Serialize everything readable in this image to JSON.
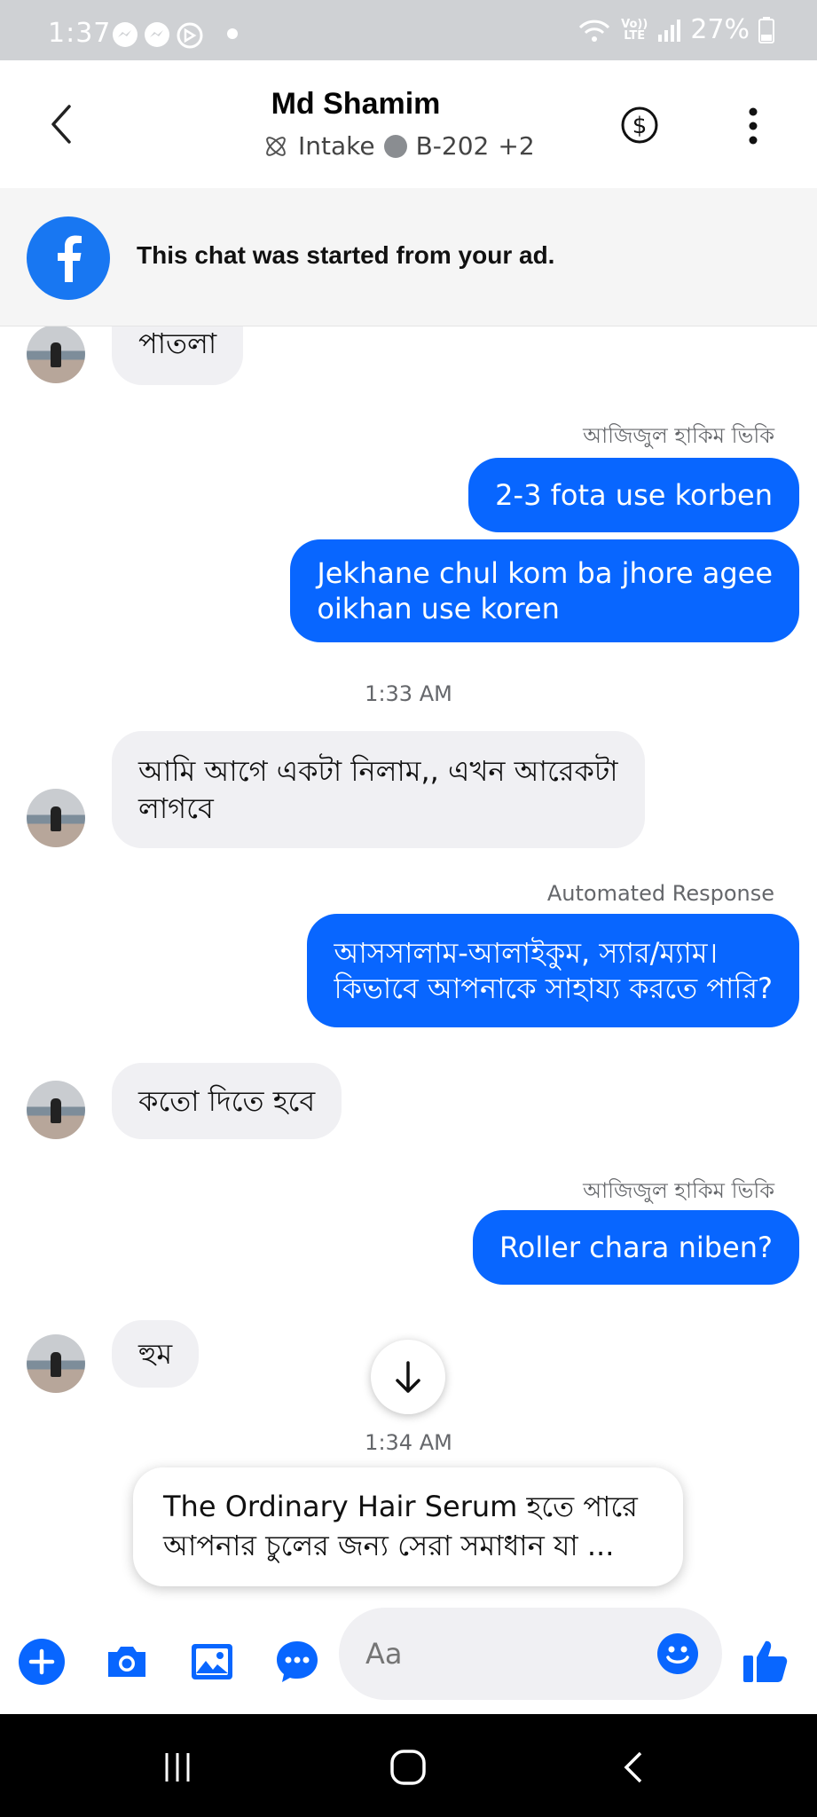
{
  "status_bar": {
    "time": "1:37",
    "battery": "27%",
    "network_label_top": "Vo))",
    "network_label_bottom": "LTE"
  },
  "header": {
    "contact_name": "Md Shamim",
    "label_intake": "Intake",
    "label_b202": "B-202",
    "label_more": "+2"
  },
  "ad_banner": {
    "text": "This chat was started from your ad."
  },
  "messages": {
    "m1_in": "পাতলা",
    "sender1": "আজিজুল হাকিম ভিকি",
    "m2_out": "2-3 fota use korben",
    "m3_out_line1": "Jekhane chul kom ba jhore agee",
    "m3_out_line2": "oikhan use koren",
    "time1": "1:33 AM",
    "m4_in_line1": "আমি আগে একটা নিলাম,, এখন আরেকটা",
    "m4_in_line2": "লাগবে",
    "sender2": "Automated Response",
    "m5_out_line1": "আসসালাম-আলাইকুম, স্যার/ম্যাম।",
    "m5_out_line2": "কিভাবে আপনাকে সাহায্য করতে পারি?",
    "m6_in": "কতো দিতে হবে",
    "sender3": "আজিজুল হাকিম ভিকি",
    "m7_out": "Roller chara niben?",
    "m8_in": "হুম",
    "time2": "1:34 AM"
  },
  "preview": {
    "line1": "The Ordinary Hair Serum হতে পারে",
    "line2": "আপনার চুলের জন্য সেরা সমাধান যা ..."
  },
  "composer": {
    "placeholder": "Aa"
  },
  "colors": {
    "accent": "#0866ff",
    "incoming_bubble": "#f0f0f3",
    "facebook_blue": "#1877f2"
  }
}
